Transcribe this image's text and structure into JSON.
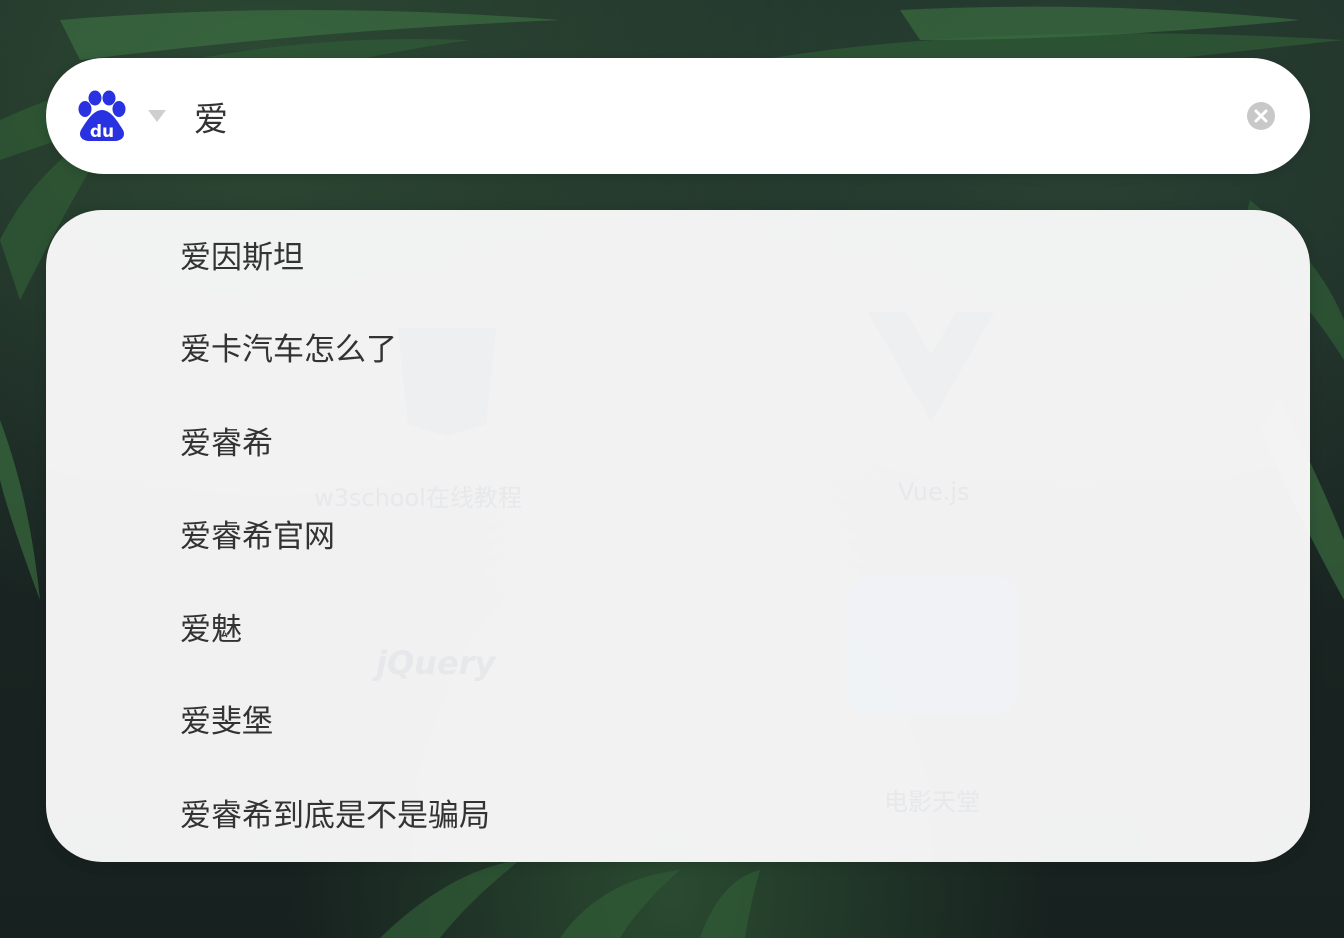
{
  "search": {
    "query": "爱",
    "engine_icon": "baidu-paw-icon",
    "clear_icon": "clear-x-icon"
  },
  "suggestions": [
    "爱因斯坦",
    "爱卡汽车怎么了",
    "爱睿希",
    "爱睿希官网",
    "爱魅",
    "爱斐堡",
    "爱睿希到底是不是骗局"
  ],
  "background_tiles": [
    {
      "label": "w3school在线教程"
    },
    {
      "label": "Vue.js"
    },
    {
      "label": "jQuery"
    },
    {
      "label": "电影天堂"
    }
  ],
  "colors": {
    "accent": "#2932e1",
    "panel": "#fafafa",
    "text": "#333333"
  }
}
